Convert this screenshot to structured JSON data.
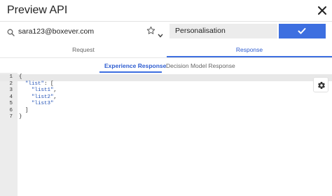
{
  "window": {
    "title": "Preview API",
    "close_icon": "close-icon"
  },
  "search": {
    "icon": "search-icon",
    "value": "sara123@boxever.com",
    "favorite_icon": "star-icon",
    "dropdown_icon": "chevron-down-icon"
  },
  "experience_select": {
    "selected": "Personalisation"
  },
  "confirm": {
    "icon": "check-icon",
    "color": "#3d6fe0"
  },
  "tabs": {
    "request_label": "Request",
    "response_label": "Response",
    "active": "Response"
  },
  "subtabs": {
    "experience_label": "Experience Response",
    "decision_label": "Decision Model Response",
    "active": "Experience Response"
  },
  "editor": {
    "lines": [
      {
        "num": "1",
        "code": "{"
      },
      {
        "num": "2",
        "code": "  \"list\": ["
      },
      {
        "num": "3",
        "code": "    \"list1\","
      },
      {
        "num": "4",
        "code": "    \"list2\","
      },
      {
        "num": "5",
        "code": "    \"list3\""
      },
      {
        "num": "6",
        "code": "  ]"
      },
      {
        "num": "7",
        "code": "}"
      }
    ],
    "active_line": "1",
    "settings_icon": "gear-icon"
  },
  "colors": {
    "accent": "#3d6fe0",
    "active_tab_text": "#2e5dd0",
    "gutter": "#ececec"
  }
}
